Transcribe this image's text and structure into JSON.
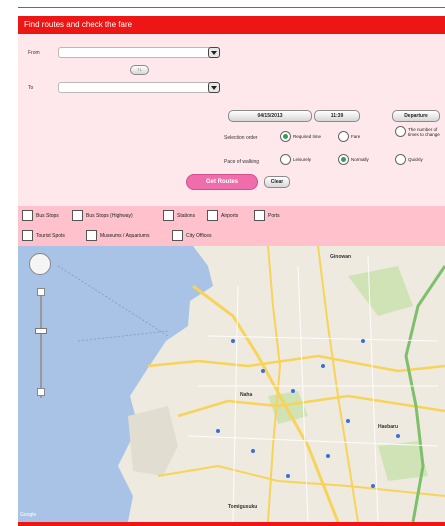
{
  "header": {
    "title": "Find routes and check the fare"
  },
  "form": {
    "from_label": "From",
    "to_label": "To",
    "from_value": "",
    "to_value": "",
    "swap_label": "↑↓",
    "date_value": "04/15/2013",
    "time_value": "11:39",
    "departure_label": "Departure",
    "selection_order_label": "Selection order",
    "selection_order_options": [
      "Required time",
      "Fare",
      "The number of times to change"
    ],
    "selection_order_selected": "Required time",
    "pace_label": "Pace of walking",
    "pace_options": [
      "Leisurely",
      "Normally",
      "Quickly"
    ],
    "pace_selected": "Normally",
    "search_button": "Get Routes",
    "clear_button": "Clear"
  },
  "filters": {
    "items": [
      "Bus Stops",
      "Bus Stops (Highway)",
      "Stations",
      "Airports",
      "Ports",
      "Tourist Spots",
      "Museums / Aquariums",
      "City Offices"
    ]
  },
  "map": {
    "labels": [
      "Ginowan",
      "Naha",
      "Haebaru",
      "Tomigusuku"
    ],
    "attribution": "Google",
    "colors": {
      "water": "#a9c3e6",
      "land": "#eeeadf",
      "road_major": "#f7d35a",
      "expressway": "#7dbf6a"
    }
  }
}
